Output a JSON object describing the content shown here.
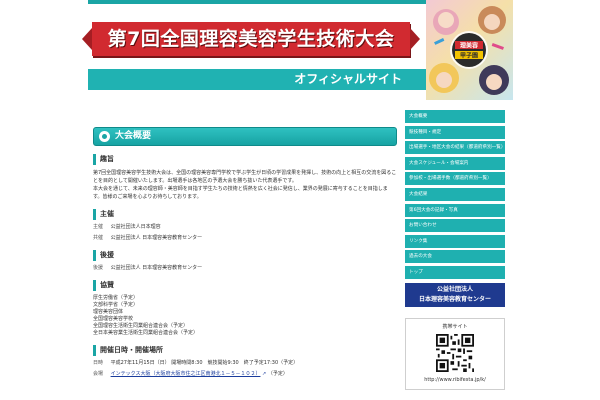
{
  "header": {
    "title": "第7回全国理容美容学生技術大会",
    "subtitle": "オフィシャルサイト",
    "illustration_badge": "理美容甲子園"
  },
  "main": {
    "section_title": "大会概要",
    "intro": {
      "heading": "趣旨",
      "lines": [
        "第7回全国理容美容学生技術大会は、全国の理容美容専門学校で学ぶ学生が日頃の学習成果を発揮し、技術の向上と相互の交流を図ることを目的として開催いたします。出場選手は各地区の予選大会を勝ち抜いた代表選手です。",
        "本大会を通じて、未来の理容師・美容師を目指す学生たちの技術と情熱を広く社会に発信し、業界の発展に寄与することを目指します。皆様のご来場を心よりお待ちしております。"
      ]
    },
    "organizer": {
      "heading": "主催",
      "rows": [
        {
          "label": "主催",
          "value": "公益社団法人日本理容"
        },
        {
          "label": "共催",
          "value": "公益社団法人 日本理容美容教育センター"
        }
      ]
    },
    "sponsor": {
      "heading": "後援",
      "rows": [
        {
          "label": "後援",
          "value": "公益社団法人 日本理容美容教育センター"
        }
      ]
    },
    "support": {
      "heading": "協賛",
      "items": [
        "厚生労働省（予定）",
        "文部科学省（予定）",
        "理容美容団体",
        "全国理容美容学校",
        "全国理容生活衛生同業組合連合会（予定）",
        "全日本美容業生活衛生同業組合連合会（予定）"
      ]
    },
    "schedule": {
      "heading": "開催日時・開催場所",
      "date_label": "日時",
      "date_value": "平成27年11月15日（日） 開場時間8:30　競技開始9:30　終了予定17:30（予定）",
      "venue_label": "会場",
      "venue_link": "インテックス大阪（大阪府大阪市住之江区南港北１－５－１０２）",
      "venue_suffix": "（予定）"
    }
  },
  "sidebar": {
    "nav": [
      "大会概要",
      "競技種目・規定",
      "出場選手・地区大会の結果（都道府県別一覧）",
      "大会スケジュール・会場案内",
      "参加校・出場選手数（都道府県別一覧）",
      "大会結果",
      "第6回大会の記録・写真",
      "お問い合わせ",
      "リンク集",
      "過去の大会",
      "トップ"
    ],
    "org_line1": "公益社団法人",
    "org_line2": "日本理容美容教育センター",
    "qr_label": "携帯サイト",
    "qr_url": "http://www.ribifesta.jp/k/"
  },
  "colors": {
    "accent": "#1aa5a5",
    "banner_red": "#d12a30",
    "org_blue": "#1f3a8f"
  }
}
